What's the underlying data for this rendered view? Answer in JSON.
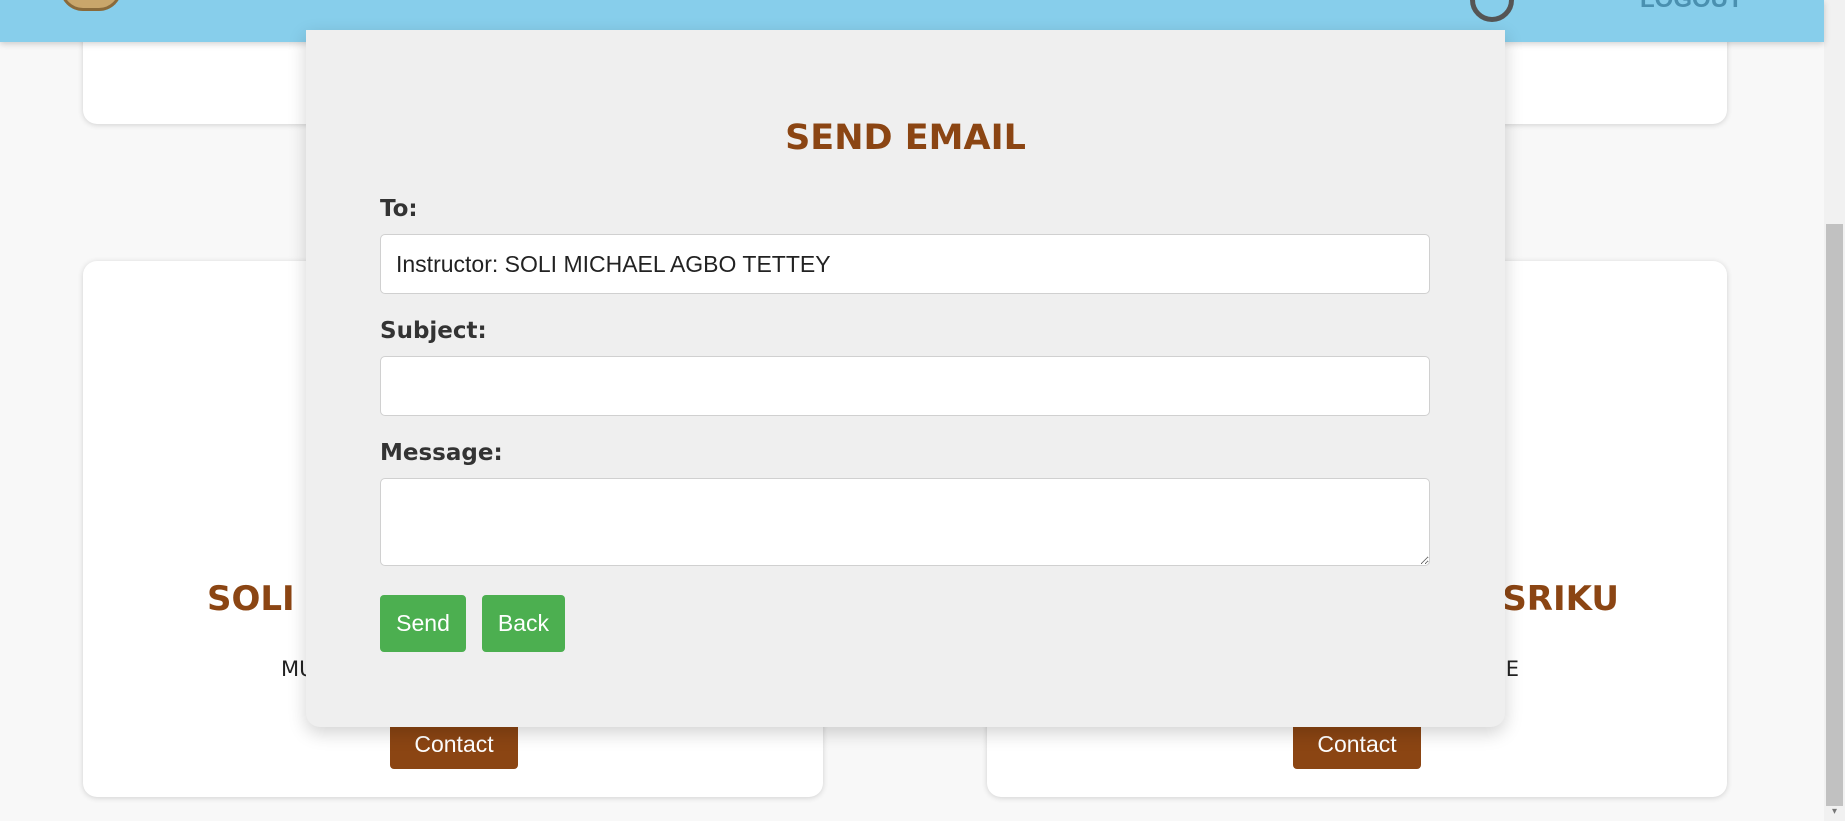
{
  "header": {
    "right_text": "LOGOUT"
  },
  "cards": {
    "left": {
      "name": "SOLI M",
      "role": "MU",
      "contact_label": "Contact"
    },
    "right": {
      "name": "TSRIKU",
      "role": "CE",
      "contact_label": "Contact"
    }
  },
  "modal": {
    "title": "SEND EMAIL",
    "to_label": "To:",
    "to_value": "Instructor: SOLI MICHAEL AGBO TETTEY",
    "subject_label": "Subject:",
    "subject_value": "",
    "message_label": "Message:",
    "message_value": "",
    "send_label": "Send",
    "back_label": "Back"
  },
  "colors": {
    "header_bg": "#87ceeb",
    "accent_brown": "#8b4513",
    "button_green": "#4caf50",
    "modal_bg": "#efefef"
  },
  "icons": {
    "logo": "emblem-logo",
    "user": "user-circle-icon",
    "scroll_down": "chevron-down-icon"
  }
}
